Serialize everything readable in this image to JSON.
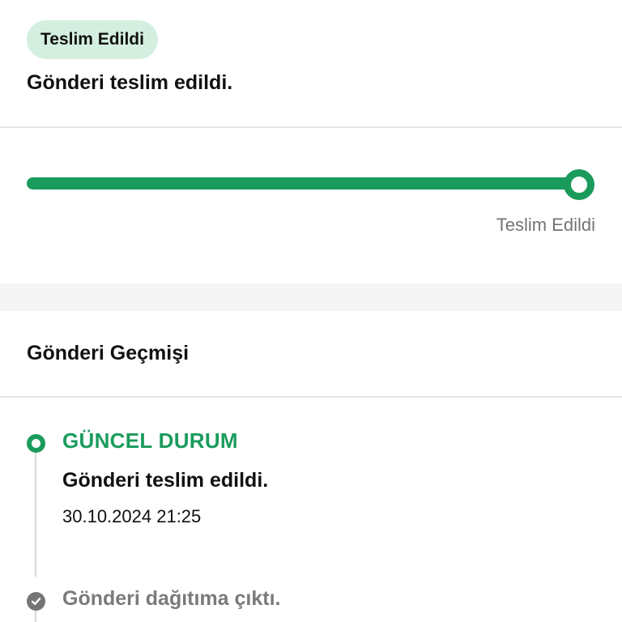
{
  "status": {
    "badge_label": "Teslim Edildi",
    "message": "Gönderi teslim edildi.",
    "badge_bg_color": "#d4efe0"
  },
  "progress": {
    "value": 1.0,
    "label": "Teslim Edildi",
    "accent_color": "#1a9b5c"
  },
  "history": {
    "title": "Gönderi Geçmişi",
    "events": [
      {
        "label": "GÜNCEL DURUM",
        "description": "Gönderi teslim edildi.",
        "datetime": "30.10.2024 21:25",
        "icon": "current-status-dot-icon"
      },
      {
        "description": "Gönderi dağıtıma çıktı.",
        "icon": "check-circle-icon"
      }
    ]
  }
}
